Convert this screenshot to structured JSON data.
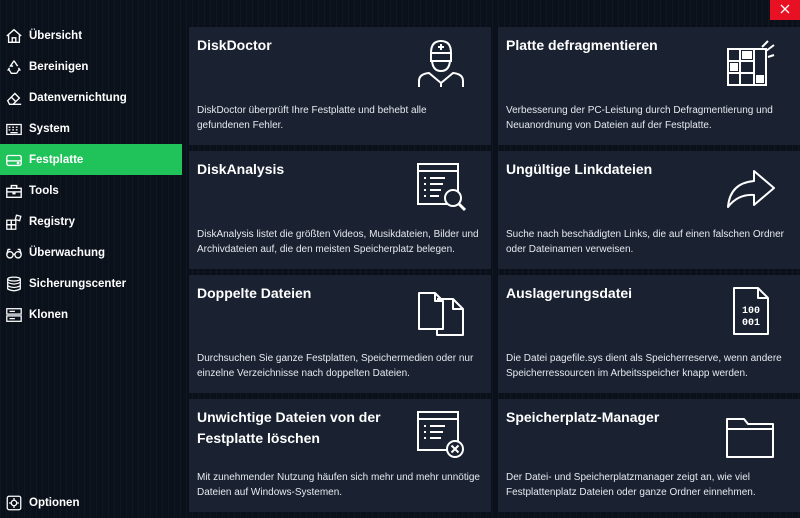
{
  "theme": {
    "accent": "#1fc35a",
    "close": "#e81123"
  },
  "sidebar": {
    "items": [
      {
        "label": "Übersicht",
        "icon": "home-icon"
      },
      {
        "label": "Bereinigen",
        "icon": "recycle-icon"
      },
      {
        "label": "Datenvernichtung",
        "icon": "eraser-icon"
      },
      {
        "label": "System",
        "icon": "keyboard-icon"
      },
      {
        "label": "Festplatte",
        "icon": "hard-disk-icon",
        "active": true
      },
      {
        "label": "Tools",
        "icon": "toolbox-icon"
      },
      {
        "label": "Registry",
        "icon": "registry-icon"
      },
      {
        "label": "Überwachung",
        "icon": "glasses-icon"
      },
      {
        "label": "Sicherungscenter",
        "icon": "database-icon"
      },
      {
        "label": "Klonen",
        "icon": "clone-icon"
      }
    ],
    "options_label": "Optionen"
  },
  "cards": [
    {
      "title": "DiskDoctor",
      "desc": "DiskDoctor überprüft Ihre Festplatte und behebt alle gefundenen Fehler.",
      "icon": "doctor-icon"
    },
    {
      "title": "Platte defragmentieren",
      "desc": "Verbesserung der PC-Leistung durch Defragmentierung und Neuanordnung von Dateien auf der Festplatte.",
      "icon": "defrag-icon"
    },
    {
      "title": "DiskAnalysis",
      "desc": "DiskAnalysis listet die größten Videos, Musikdateien, Bilder und Archivdateien auf, die den meisten Speicherplatz belegen.",
      "icon": "magnifier-document-icon"
    },
    {
      "title": "Ungültige Linkdateien",
      "desc": "Suche nach beschädigten Links, die auf einen falschen Ordner oder Dateinamen verweisen.",
      "icon": "share-arrow-icon"
    },
    {
      "title": "Doppelte Dateien",
      "desc": "Durchsuchen Sie ganze Festplatten, Speichermedien oder nur einzelne Verzeichnisse nach doppelten Dateien.",
      "icon": "duplicate-files-icon"
    },
    {
      "title": "Auslagerungsdatei",
      "desc": "Die Datei pagefile.sys dient als Speicherreserve, wenn andere Speicherressourcen im Arbeitsspeicher knapp werden.",
      "icon": "binary-file-icon",
      "icon_text_1": "100",
      "icon_text_2": "001"
    },
    {
      "title": "Unwichtige Dateien von der Festplatte löschen",
      "desc": "Mit zunehmender Nutzung häufen sich mehr und mehr unnötige Dateien auf Windows-Systemen.",
      "icon": "delete-document-icon"
    },
    {
      "title": "Speicherplatz-Manager",
      "desc": "Der Datei- und Speicherplatzmanager zeigt an, wie viel Festplattenplatz Dateien oder ganze Ordner einnehmen.",
      "icon": "folder-icon"
    }
  ]
}
